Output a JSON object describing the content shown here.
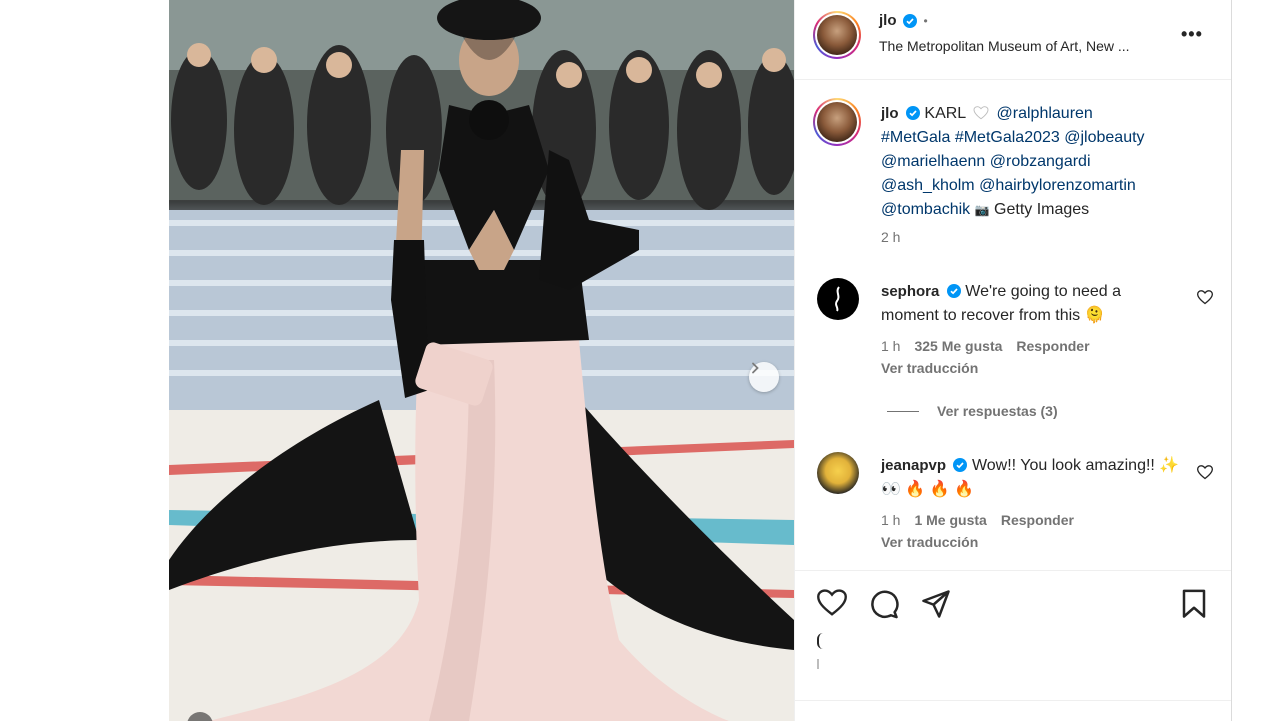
{
  "post": {
    "username": "jlo",
    "location": "The Metropolitan Museum of Art, New ...",
    "more_label": "•••"
  },
  "caption": {
    "username": "jlo",
    "text_start": "KARL",
    "mention_1": "@ralphlauren",
    "mention_2": "#MetGala",
    "mention_3": "#MetGala2023",
    "mention_4": "@jlobeauty",
    "mention_5": "@marielhaenn",
    "mention_6": "@robzangardi",
    "mention_7": "@ash_kholm",
    "mention_8": "@hairbylorenzomartin",
    "mention_9": "@tombachik",
    "text_end": "Getty Images",
    "time": "2 h"
  },
  "comments": [
    {
      "username": "sephora",
      "text": "We're going to need a moment to recover from this 🫠",
      "time": "1 h",
      "likes": "325 Me gusta",
      "reply": "Responder",
      "translate": "Ver traducción"
    },
    {
      "username": "jeanapvp",
      "text": "Wow!! You look amazing!! ✨ 👀 🔥 🔥 🔥",
      "time": "1 h",
      "likes": "1 Me gusta",
      "reply": "Responder",
      "translate": "Ver traducción"
    }
  ],
  "replies_label": "Ver respuestas (3)",
  "colors": {
    "verified": "#0095f6",
    "mention": "#00376b",
    "secondary_text": "#737373"
  },
  "icons": [
    "heart-icon",
    "comment-icon",
    "share-icon",
    "bookmark-icon",
    "chevron-right-icon",
    "verified-icon",
    "more-icon"
  ]
}
